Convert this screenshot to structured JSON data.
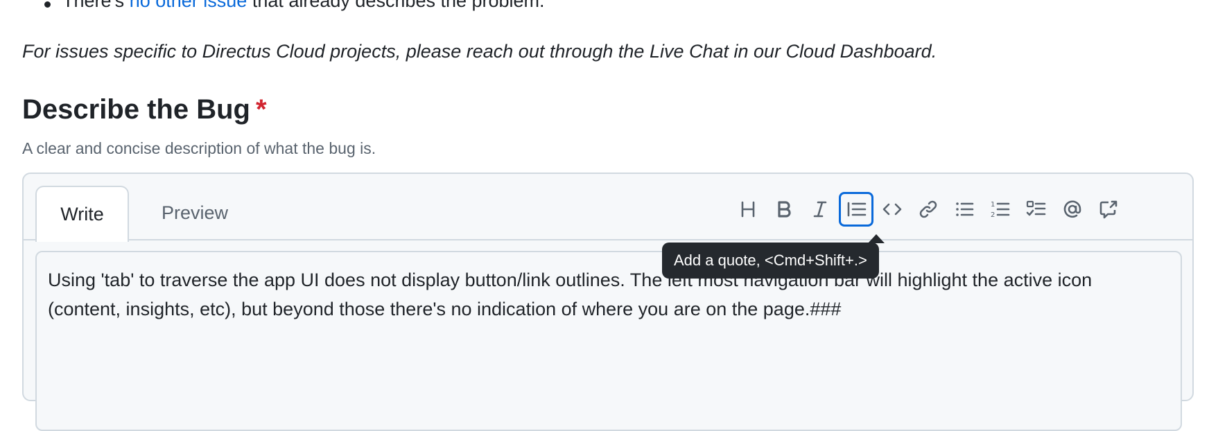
{
  "checklist": {
    "prefix": "There's ",
    "link_text": "no other issue",
    "suffix": " that already describes the problem."
  },
  "note": "For issues specific to Directus Cloud projects, please reach out through the Live Chat in our Cloud Dashboard.",
  "field": {
    "title": "Describe the Bug",
    "required_mark": "*",
    "description": "A clear and concise description of what the bug is."
  },
  "editor": {
    "tabs": [
      {
        "label": "Write",
        "active": true
      },
      {
        "label": "Preview",
        "active": false
      }
    ],
    "toolbar": [
      {
        "icon": "heading-icon",
        "focused": false
      },
      {
        "icon": "bold-icon",
        "focused": false
      },
      {
        "icon": "italic-icon",
        "focused": false
      },
      {
        "icon": "quote-icon",
        "focused": true
      },
      {
        "icon": "code-icon",
        "focused": false
      },
      {
        "icon": "link-icon",
        "focused": false
      },
      {
        "icon": "unordered-list-icon",
        "focused": false
      },
      {
        "icon": "ordered-list-icon",
        "focused": false
      },
      {
        "icon": "task-list-icon",
        "focused": false
      },
      {
        "icon": "mention-icon",
        "focused": false
      },
      {
        "icon": "reference-icon",
        "focused": false
      }
    ],
    "tooltip": "Add a quote, <Cmd+Shift+.>",
    "value": "Using 'tab' to traverse the app UI does not display button/link outlines. The left most navigation bar will highlight the active icon (content, insights, etc), but beyond those there's no indication of where you are on the page.###"
  },
  "colors": {
    "link": "#0969da",
    "required": "#d1242f",
    "focus_ring": "#0969da",
    "tooltip_bg": "#25292e"
  }
}
